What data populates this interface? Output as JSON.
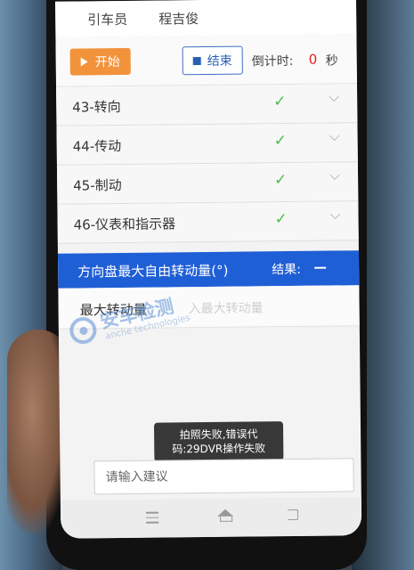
{
  "header": {
    "driver_label": "引车员",
    "driver_name": "程吉俊"
  },
  "controls": {
    "start_label": "开始",
    "end_label": "结束",
    "countdown_label": "倒计时:",
    "countdown_value": "0",
    "countdown_unit": "秒"
  },
  "items": [
    {
      "label": "43-转向",
      "status": "✓"
    },
    {
      "label": "44-传动",
      "status": "✓"
    },
    {
      "label": "45-制动",
      "status": "✓"
    },
    {
      "label": "46-仪表和指示器",
      "status": "✓"
    }
  ],
  "selected": {
    "title": "方向盘最大自由转动量(°)",
    "result_label": "结果:"
  },
  "sub_item": {
    "label": "最大转动量",
    "placeholder": "入最大转动量"
  },
  "watermark": {
    "text": "安车检测",
    "subtext": "anche technologies"
  },
  "toast": {
    "line1": "拍照失败,错误代",
    "line2": "码:29DVR操作失败"
  },
  "suggestion": {
    "placeholder": "请输入建议"
  },
  "colors": {
    "accent_blue": "#1f5fd6",
    "start_orange": "#f2923a",
    "check_green": "#4cbb4c",
    "countdown_red": "#e02020"
  }
}
